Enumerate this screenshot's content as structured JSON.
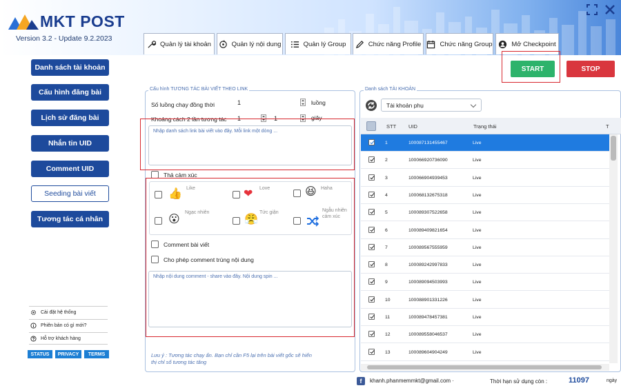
{
  "app": {
    "logo": "MKT POST",
    "version": "Version 3.2 - Update 9.2.2023"
  },
  "tabs": [
    {
      "label": "Quản lý tài khoản",
      "icon": "wrench-icon"
    },
    {
      "label": "Quản lý nội dung",
      "icon": "refresh-icon"
    },
    {
      "label": "Quản lý Group",
      "icon": "list-icon"
    },
    {
      "label": "Chức năng Profile",
      "icon": "pencil-icon"
    },
    {
      "label": "Chức năng Group",
      "icon": "calendar-icon"
    },
    {
      "label": "Mở Checkpoint",
      "icon": "user-icon"
    }
  ],
  "sidebar": {
    "items": [
      {
        "label": "Danh sách tài khoản"
      },
      {
        "label": "Cấu hình đăng bài"
      },
      {
        "label": "Lịch sử đăng bài"
      },
      {
        "label": "Nhắn tin UID"
      },
      {
        "label": "Comment UID"
      },
      {
        "label": "Seeding bài viết"
      },
      {
        "label": "Tương tác cá nhân"
      }
    ],
    "system": [
      {
        "label": "Cài đặt hệ thống",
        "icon": "gear-icon"
      },
      {
        "label": "Phiên bản có gì mới?",
        "icon": "info-icon"
      },
      {
        "label": "Hỗ trợ khách hàng",
        "icon": "help-icon"
      }
    ],
    "links": {
      "status": "STATUS",
      "privacy": "PRIVACY",
      "terms": "TERMS"
    }
  },
  "actions": {
    "start": "START",
    "stop": "STOP"
  },
  "config": {
    "title": "Cấu hình TƯƠNG TÁC BÀI VIẾT THEO LINK",
    "threads_label": "Số luồng chạy đồng thời",
    "threads_value": "1",
    "threads_unit": "luồng",
    "interval_label": "Khoảng cách 2 lần tương tác",
    "interval_min": "1",
    "interval_max": "1",
    "interval_unit": "giây",
    "links_placeholder": "Nhập danh sách link bài viết vào đây. Mỗi link một dòng ...",
    "reaction_label": "Thả cảm xúc",
    "reactions": [
      {
        "label": "Like",
        "icon": "like-icon"
      },
      {
        "label": "Love",
        "icon": "love-icon"
      },
      {
        "label": "Haha",
        "icon": "haha-icon"
      },
      {
        "label": "Ngạc nhiên",
        "icon": "wow-icon"
      },
      {
        "label": "Tức giận",
        "icon": "angry-icon"
      },
      {
        "label": "Ngẫu nhiên cảm xúc",
        "icon": "shuffle-icon"
      }
    ],
    "comment_label": "Comment bài viết",
    "allow_dup_label": "Cho phép comment trùng nội dung",
    "comment_placeholder": "Nhập nội dung comment - share vào đây. Nội dung spin ...",
    "note": "Lưu ý : Tương tác chạy ẩn. Bạn chỉ cần F5 lại trên bài viết gốc sẽ hiển thị chỉ số tương tác tăng"
  },
  "accounts": {
    "title": "Danh sách TÀI KHOẢN",
    "filter": "Tài khoản phụ",
    "columns": {
      "stt": "STT",
      "uid": "UID",
      "status": "Trạng thái",
      "extra": "T"
    },
    "rows": [
      {
        "stt": "1",
        "uid": "100087131455467",
        "status": "Live"
      },
      {
        "stt": "2",
        "uid": "100066920736090",
        "status": "Live"
      },
      {
        "stt": "3",
        "uid": "100066904939453",
        "status": "Live"
      },
      {
        "stt": "4",
        "uid": "100068132675318",
        "status": "Live"
      },
      {
        "stt": "5",
        "uid": "100089307522658",
        "status": "Live"
      },
      {
        "stt": "6",
        "uid": "100089409821654",
        "status": "Live"
      },
      {
        "stt": "7",
        "uid": "100089567555959",
        "status": "Live"
      },
      {
        "stt": "8",
        "uid": "100089242997833",
        "status": "Live"
      },
      {
        "stt": "9",
        "uid": "100089094503993",
        "status": "Live"
      },
      {
        "stt": "10",
        "uid": "100088901331226",
        "status": "Live"
      },
      {
        "stt": "11",
        "uid": "100089478457381",
        "status": "Live"
      },
      {
        "stt": "12",
        "uid": "100089558046537",
        "status": "Live"
      },
      {
        "stt": "13",
        "uid": "100089604904249",
        "status": "Live"
      }
    ]
  },
  "footer": {
    "email": "khanh.phanmemmkt@gmail.com",
    "email_chev": "·",
    "expiry_label": "Thời hạn sử dụng còn :",
    "expiry_value": "11097",
    "expiry_unit": "ngày"
  },
  "colors": {
    "primary": "#1d4a9c",
    "start": "#2db36b",
    "stop": "#d9363e",
    "selected": "#1f7be0",
    "highlight": "#d7262d"
  }
}
